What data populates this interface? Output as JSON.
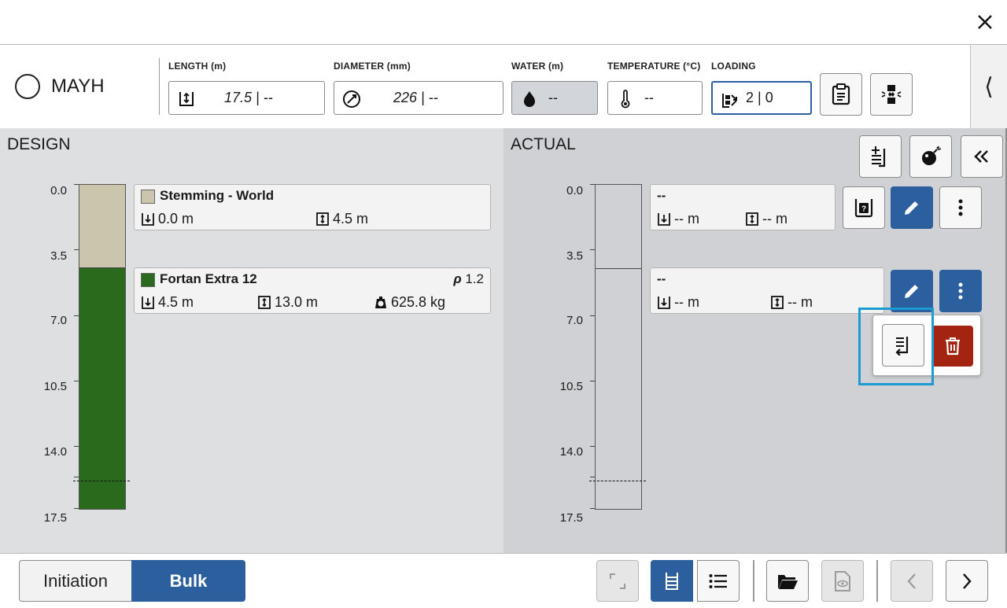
{
  "hole": {
    "name": "MAYH"
  },
  "fields": {
    "length": {
      "label": "LENGTH (m)",
      "value": "17.5 | --"
    },
    "diameter": {
      "label": "DIAMETER (mm)",
      "value": "226 | --"
    },
    "water": {
      "label": "WATER (m)",
      "value": "--"
    },
    "temperature": {
      "label": "TEMPERATURE (°C)",
      "value": "--"
    },
    "loading": {
      "label": "LOADING",
      "value": "2 | 0"
    }
  },
  "design": {
    "title": "DESIGN",
    "ticks": [
      "0.0",
      "3.5",
      "7.0",
      "10.5",
      "14.0",
      "17.5"
    ],
    "decks": [
      {
        "name": "Stemming - World",
        "color": "#cbc5ae",
        "from": "0.0 m",
        "length": "4.5 m"
      },
      {
        "name": "Fortan Extra 12",
        "color": "#2a6a1c",
        "density_symbol": "ρ",
        "density": "1.2",
        "from": "4.5 m",
        "length": "13.0 m",
        "mass": "625.8 kg"
      }
    ],
    "column": {
      "total_depth": 17.5,
      "deck_tops": [
        0,
        4.5
      ],
      "dashed_depth": 16.0
    }
  },
  "actual": {
    "title": "ACTUAL",
    "ticks": [
      "0.0",
      "3.5",
      "7.0",
      "10.5",
      "14.0",
      "17.5"
    ],
    "decks": [
      {
        "name": "--",
        "from": "-- m",
        "length": "-- m"
      },
      {
        "name": "--",
        "from": "-- m",
        "length": "-- m"
      }
    ]
  },
  "bottom": {
    "initiation_label": "Initiation",
    "bulk_label": "Bulk"
  },
  "colors": {
    "primary": "#2c5f9e",
    "danger": "#a32410",
    "highlight": "#1b9bd1",
    "stemming": "#cbc5ae",
    "explosive": "#2a6a1c"
  }
}
